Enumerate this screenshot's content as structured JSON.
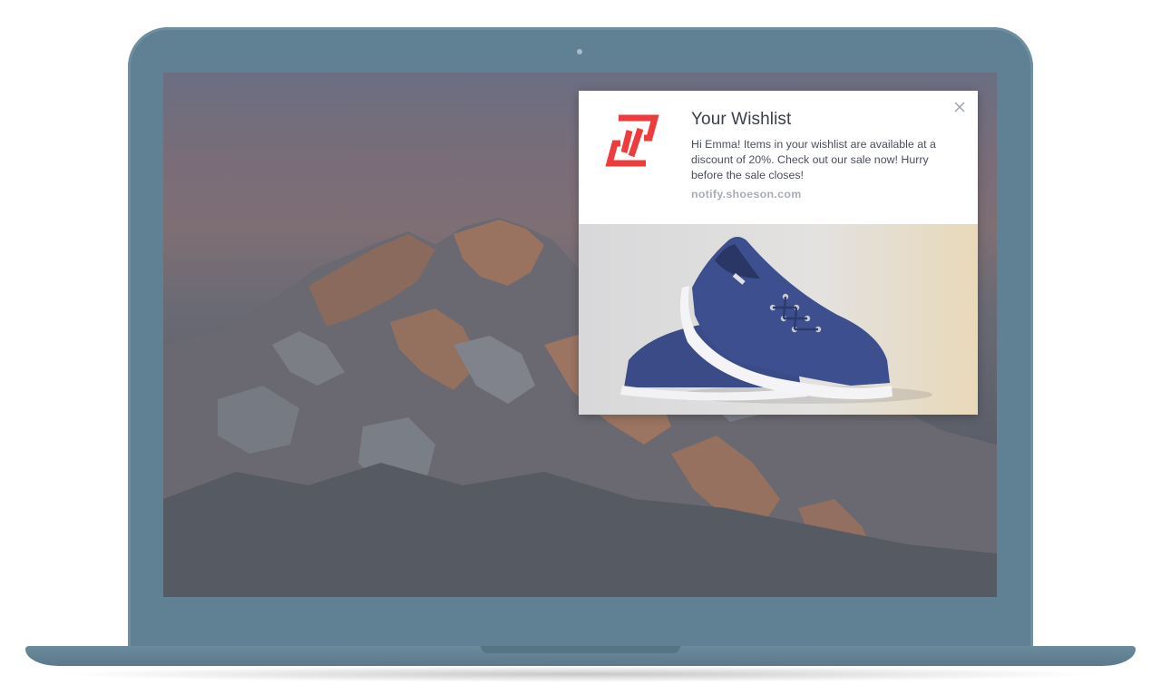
{
  "notification": {
    "title": "Your Wishlist",
    "body": "Hi Emma! Items in your wishlist are available at a discount of 20%. Check out our sale now! Hurry before the sale closes!",
    "domain": "notify.shoeson.com",
    "logo_icon": "shoeson-logo-icon",
    "close_icon": "close-icon",
    "image": "blue-sneakers-image"
  },
  "colors": {
    "brand": "#ee3b3b",
    "device": "#5f8193",
    "title_text": "#3a3f4a",
    "body_text": "#4a4f5a",
    "domain_text": "#a9adb4",
    "shoe": "#3d4f8e"
  }
}
